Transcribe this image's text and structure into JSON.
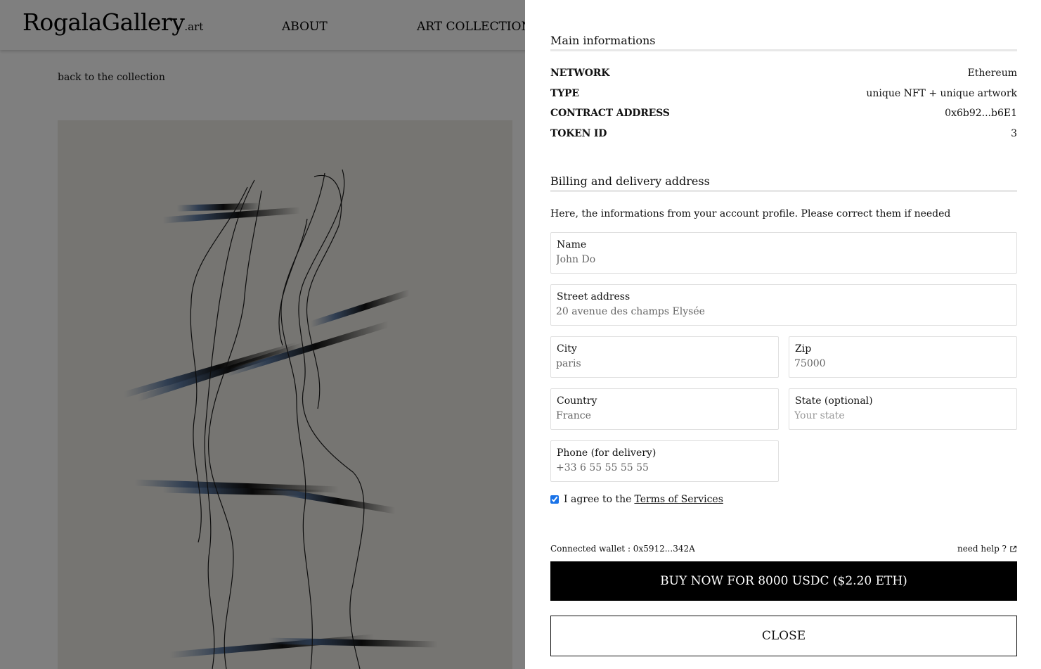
{
  "header": {
    "logo_main": "RogalaGallery",
    "logo_suffix": ".art",
    "nav": [
      "ABOUT",
      "ART COLLECTIONS"
    ]
  },
  "page": {
    "back_link": "back to the collection"
  },
  "main_info": {
    "title": "Main informations",
    "rows": [
      {
        "label": "NETWORK",
        "value": "Ethereum"
      },
      {
        "label": "TYPE",
        "value": "unique NFT + unique artwork"
      },
      {
        "label": "CONTRACT ADDRESS",
        "value": "0x6b92...b6E1"
      },
      {
        "label": "TOKEN ID",
        "value": "3"
      }
    ]
  },
  "billing": {
    "title": "Billing and delivery address",
    "helper": "Here, the informations from your account profile. Please correct them if needed",
    "name": {
      "label": "Name",
      "value": "John Do"
    },
    "street": {
      "label": "Street address",
      "value": "20 avenue des champs Elysée"
    },
    "city": {
      "label": "City",
      "value": "paris"
    },
    "zip": {
      "label": "Zip",
      "value": "75000"
    },
    "country": {
      "label": "Country",
      "value": "France"
    },
    "state": {
      "label": "State (optional)",
      "value": "",
      "placeholder": "Your state"
    },
    "phone": {
      "label": "Phone (for delivery)",
      "value": "+33 6 55 55 55 55"
    }
  },
  "terms": {
    "checked": true,
    "prefix": "I agree to the",
    "link": "Terms of Services"
  },
  "footer": {
    "wallet": "Connected wallet : 0x5912...342A",
    "help": "need help ?",
    "buy_label": "BUY NOW FOR 8000 USDC ($2.20 ETH)",
    "close_label": "CLOSE"
  },
  "icons": {
    "help": "external-link-icon"
  }
}
